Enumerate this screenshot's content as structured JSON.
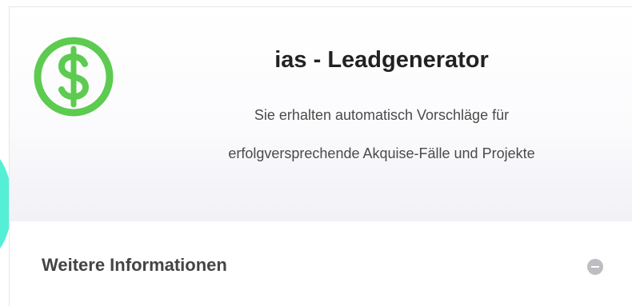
{
  "card": {
    "title": "ias - Leadgenerator",
    "description_line1": "Sie erhalten automatisch Vorschläge für",
    "description_line2": "erfolgversprechende Akquise-Fälle und Projekte",
    "logo_icon": "dollar-coin-icon",
    "logo_color": "#5ccb50"
  },
  "accordion": {
    "label": "Weitere Informationen",
    "toggle_icon": "minus-circle-icon"
  }
}
